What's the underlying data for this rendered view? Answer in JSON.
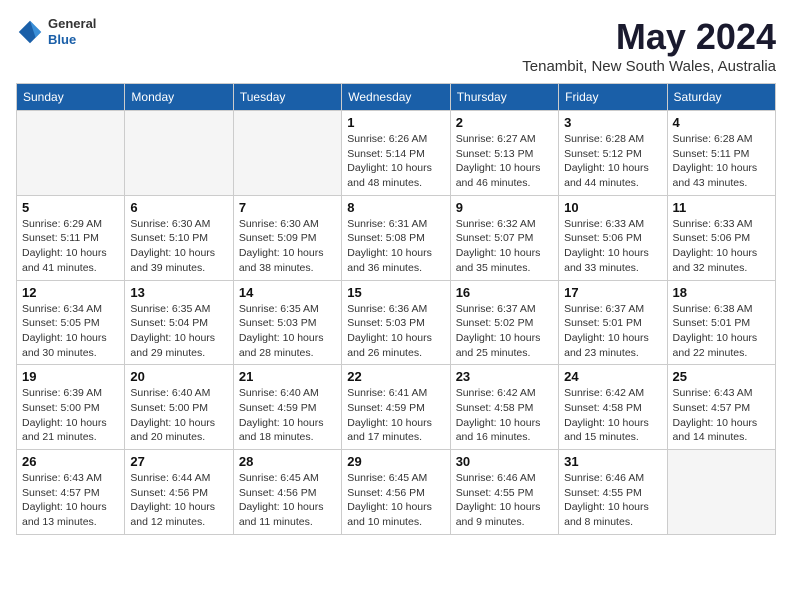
{
  "logo": {
    "general": "General",
    "blue": "Blue"
  },
  "header": {
    "month_year": "May 2024",
    "location": "Tenambit, New South Wales, Australia"
  },
  "weekdays": [
    "Sunday",
    "Monday",
    "Tuesday",
    "Wednesday",
    "Thursday",
    "Friday",
    "Saturday"
  ],
  "weeks": [
    [
      {
        "day": "",
        "info": ""
      },
      {
        "day": "",
        "info": ""
      },
      {
        "day": "",
        "info": ""
      },
      {
        "day": "1",
        "info": "Sunrise: 6:26 AM\nSunset: 5:14 PM\nDaylight: 10 hours\nand 48 minutes."
      },
      {
        "day": "2",
        "info": "Sunrise: 6:27 AM\nSunset: 5:13 PM\nDaylight: 10 hours\nand 46 minutes."
      },
      {
        "day": "3",
        "info": "Sunrise: 6:28 AM\nSunset: 5:12 PM\nDaylight: 10 hours\nand 44 minutes."
      },
      {
        "day": "4",
        "info": "Sunrise: 6:28 AM\nSunset: 5:11 PM\nDaylight: 10 hours\nand 43 minutes."
      }
    ],
    [
      {
        "day": "5",
        "info": "Sunrise: 6:29 AM\nSunset: 5:11 PM\nDaylight: 10 hours\nand 41 minutes."
      },
      {
        "day": "6",
        "info": "Sunrise: 6:30 AM\nSunset: 5:10 PM\nDaylight: 10 hours\nand 39 minutes."
      },
      {
        "day": "7",
        "info": "Sunrise: 6:30 AM\nSunset: 5:09 PM\nDaylight: 10 hours\nand 38 minutes."
      },
      {
        "day": "8",
        "info": "Sunrise: 6:31 AM\nSunset: 5:08 PM\nDaylight: 10 hours\nand 36 minutes."
      },
      {
        "day": "9",
        "info": "Sunrise: 6:32 AM\nSunset: 5:07 PM\nDaylight: 10 hours\nand 35 minutes."
      },
      {
        "day": "10",
        "info": "Sunrise: 6:33 AM\nSunset: 5:06 PM\nDaylight: 10 hours\nand 33 minutes."
      },
      {
        "day": "11",
        "info": "Sunrise: 6:33 AM\nSunset: 5:06 PM\nDaylight: 10 hours\nand 32 minutes."
      }
    ],
    [
      {
        "day": "12",
        "info": "Sunrise: 6:34 AM\nSunset: 5:05 PM\nDaylight: 10 hours\nand 30 minutes."
      },
      {
        "day": "13",
        "info": "Sunrise: 6:35 AM\nSunset: 5:04 PM\nDaylight: 10 hours\nand 29 minutes."
      },
      {
        "day": "14",
        "info": "Sunrise: 6:35 AM\nSunset: 5:03 PM\nDaylight: 10 hours\nand 28 minutes."
      },
      {
        "day": "15",
        "info": "Sunrise: 6:36 AM\nSunset: 5:03 PM\nDaylight: 10 hours\nand 26 minutes."
      },
      {
        "day": "16",
        "info": "Sunrise: 6:37 AM\nSunset: 5:02 PM\nDaylight: 10 hours\nand 25 minutes."
      },
      {
        "day": "17",
        "info": "Sunrise: 6:37 AM\nSunset: 5:01 PM\nDaylight: 10 hours\nand 23 minutes."
      },
      {
        "day": "18",
        "info": "Sunrise: 6:38 AM\nSunset: 5:01 PM\nDaylight: 10 hours\nand 22 minutes."
      }
    ],
    [
      {
        "day": "19",
        "info": "Sunrise: 6:39 AM\nSunset: 5:00 PM\nDaylight: 10 hours\nand 21 minutes."
      },
      {
        "day": "20",
        "info": "Sunrise: 6:40 AM\nSunset: 5:00 PM\nDaylight: 10 hours\nand 20 minutes."
      },
      {
        "day": "21",
        "info": "Sunrise: 6:40 AM\nSunset: 4:59 PM\nDaylight: 10 hours\nand 18 minutes."
      },
      {
        "day": "22",
        "info": "Sunrise: 6:41 AM\nSunset: 4:59 PM\nDaylight: 10 hours\nand 17 minutes."
      },
      {
        "day": "23",
        "info": "Sunrise: 6:42 AM\nSunset: 4:58 PM\nDaylight: 10 hours\nand 16 minutes."
      },
      {
        "day": "24",
        "info": "Sunrise: 6:42 AM\nSunset: 4:58 PM\nDaylight: 10 hours\nand 15 minutes."
      },
      {
        "day": "25",
        "info": "Sunrise: 6:43 AM\nSunset: 4:57 PM\nDaylight: 10 hours\nand 14 minutes."
      }
    ],
    [
      {
        "day": "26",
        "info": "Sunrise: 6:43 AM\nSunset: 4:57 PM\nDaylight: 10 hours\nand 13 minutes."
      },
      {
        "day": "27",
        "info": "Sunrise: 6:44 AM\nSunset: 4:56 PM\nDaylight: 10 hours\nand 12 minutes."
      },
      {
        "day": "28",
        "info": "Sunrise: 6:45 AM\nSunset: 4:56 PM\nDaylight: 10 hours\nand 11 minutes."
      },
      {
        "day": "29",
        "info": "Sunrise: 6:45 AM\nSunset: 4:56 PM\nDaylight: 10 hours\nand 10 minutes."
      },
      {
        "day": "30",
        "info": "Sunrise: 6:46 AM\nSunset: 4:55 PM\nDaylight: 10 hours\nand 9 minutes."
      },
      {
        "day": "31",
        "info": "Sunrise: 6:46 AM\nSunset: 4:55 PM\nDaylight: 10 hours\nand 8 minutes."
      },
      {
        "day": "",
        "info": ""
      }
    ]
  ]
}
